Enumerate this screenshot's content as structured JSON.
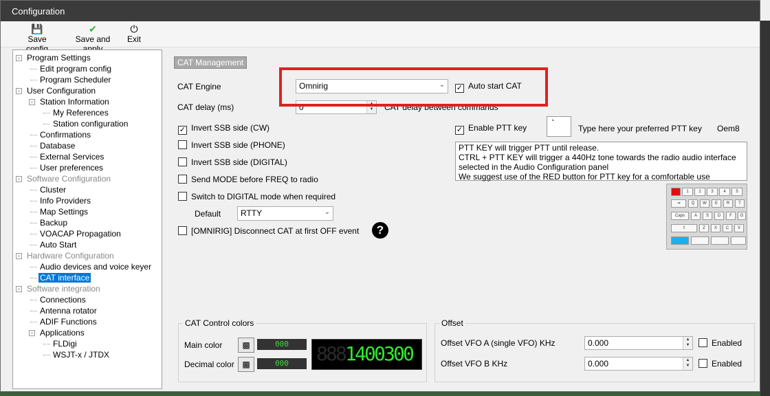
{
  "window": {
    "title": "Configuration"
  },
  "toolbar": {
    "save_config": "Save config",
    "save_and_apply": "Save and apply",
    "exit": "Exit"
  },
  "tree": [
    {
      "label": "Program Settings",
      "level": 0,
      "expander": "-",
      "grey": false
    },
    {
      "label": "Edit program config",
      "level": 1
    },
    {
      "label": "Program Scheduler",
      "level": 1
    },
    {
      "label": "User Configuration",
      "level": 0,
      "expander": "-"
    },
    {
      "label": "Station Information",
      "level": 1,
      "expander": "-"
    },
    {
      "label": "My References",
      "level": 2
    },
    {
      "label": "Station configuration",
      "level": 2
    },
    {
      "label": "Confirmations",
      "level": 1
    },
    {
      "label": "Database",
      "level": 1
    },
    {
      "label": "External Services",
      "level": 1
    },
    {
      "label": "User preferences",
      "level": 1
    },
    {
      "label": "Software Configuration",
      "level": 0,
      "expander": "-",
      "grey": true
    },
    {
      "label": "Cluster",
      "level": 1
    },
    {
      "label": "Info Providers",
      "level": 1
    },
    {
      "label": "Map Settings",
      "level": 1
    },
    {
      "label": "Backup",
      "level": 1
    },
    {
      "label": "VOACAP Propagation",
      "level": 1
    },
    {
      "label": "Auto Start",
      "level": 1
    },
    {
      "label": "Hardware Configuration",
      "level": 0,
      "expander": "-",
      "grey": true
    },
    {
      "label": "Audio devices and voice keyer",
      "level": 1
    },
    {
      "label": "CAT interface",
      "level": 1,
      "selected": true
    },
    {
      "label": "Software integration",
      "level": 0,
      "expander": "-",
      "grey": true
    },
    {
      "label": "Connections",
      "level": 1
    },
    {
      "label": "Antenna rotator",
      "level": 1
    },
    {
      "label": "ADIF Functions",
      "level": 1
    },
    {
      "label": "Applications",
      "level": 1,
      "expander": "-"
    },
    {
      "label": "FLDigi",
      "level": 2
    },
    {
      "label": "WSJT-x / JTDX",
      "level": 2
    }
  ],
  "cat": {
    "section_title": "CAT Management",
    "engine_label": "CAT Engine",
    "engine_value": "Omnirig",
    "auto_start_label": "Auto start CAT",
    "auto_start_checked": true,
    "delay_label": "CAT delay (ms)",
    "delay_value": "0",
    "delay_hint": "CAT delay between commands"
  },
  "options": [
    {
      "label": "Invert SSB side (CW)",
      "checked": true
    },
    {
      "label": "Invert SSB side (PHONE)",
      "checked": false
    },
    {
      "label": "Invert SSB side (DIGITAL)",
      "checked": false
    },
    {
      "label": "Send MODE before FREQ to radio",
      "checked": false
    },
    {
      "label": "Switch to DIGITAL mode when required",
      "checked": false
    }
  ],
  "default_mode": {
    "label": "Default",
    "value": "RTTY"
  },
  "omnirig_disconnect": {
    "label": "[OMNIRIG] Disconnect CAT at first OFF event",
    "checked": false
  },
  "ptt": {
    "enable_label": "Enable PTT key",
    "enable_checked": true,
    "key_glyph": "`",
    "hint": "Type here your preferred PTT key",
    "key_name": "Oem8",
    "info_lines": [
      "PTT KEY will trigger PTT until release.",
      "CTRL + PTT KEY will trigger a 440Hz tone towards the radio audio interface",
      "selected in the Audio Configuration panel",
      "We suggest use of the RED button for PTT key for a comfortable use"
    ]
  },
  "colors": {
    "group_title": "CAT Control colors",
    "main_label": "Main color",
    "main_value": "000",
    "decimal_label": "Decimal color",
    "decimal_value": "000",
    "lcd_digits": [
      "8",
      "8",
      "8",
      "1",
      "4",
      "0",
      "0",
      "3",
      "0",
      "0"
    ],
    "lcd_on": [
      false,
      false,
      false,
      true,
      true,
      true,
      true,
      true,
      true,
      true
    ]
  },
  "offset": {
    "group_title": "Offset",
    "vfo_a_label": "Offset VFO A (single VFO) KHz",
    "vfo_a_value": "0.000",
    "vfo_b_label": "Offset VFO B KHz",
    "vfo_b_value": "0.000",
    "enabled_label": "Enabled"
  }
}
